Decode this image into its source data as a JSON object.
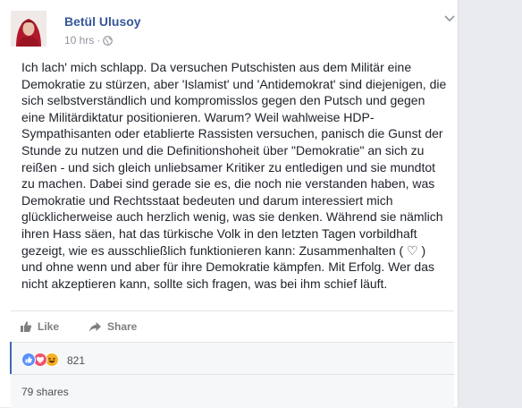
{
  "post": {
    "author": "Betül Ulusoy",
    "time": "10 hrs",
    "separator": "·",
    "text": "Ich lach' mich schlapp. Da versuchen Putschisten aus dem Militär eine\nDemokratie zu stürzen, aber 'Islamist' und 'Antidemokrat' sind diejenigen, die\nsich selbstverständlich und kompromisslos gegen den Putsch und gegen\neine Militärdiktatur positionieren. Warum? Weil wahlweise HDP-\nSympathisanten oder etablierte Rassisten versuchen, panisch die Gunst der\nStunde zu nutzen und die Definitionshoheit über \"Demokratie\" an sich zu\nreißen - und sich gleich unliebsamer Kritiker zu entledigen und sie mundtot\nzu machen. Dabei sind gerade sie es, die noch nie verstanden haben, was\nDemokratie und Rechtsstaat bedeuten und darum interessiert mich\nglücklicherweise auch herzlich wenig, was sie denken. Während sie nämlich\nihren Hass säen, hat das türkische Volk in den letzten Tagen vorbildhaft\ngezeigt, wie es ausschließlich funktionieren kann: Zusammenhalten ( ♡ )\nund ohne wenn und aber für ihre Demokratie kämpfen. Mit Erfolg. Wer das\nnicht akzeptieren kann, sollte sich fragen, was bei ihm schief läuft."
  },
  "actions": {
    "like_label": "Like",
    "share_label": "Share"
  },
  "reactions": {
    "count": "821",
    "types": [
      "like",
      "love",
      "haha"
    ],
    "colors": {
      "like": "#5890ff",
      "love": "#f25268",
      "haha": "#f7b125"
    }
  },
  "shares": {
    "label": "79 shares"
  }
}
